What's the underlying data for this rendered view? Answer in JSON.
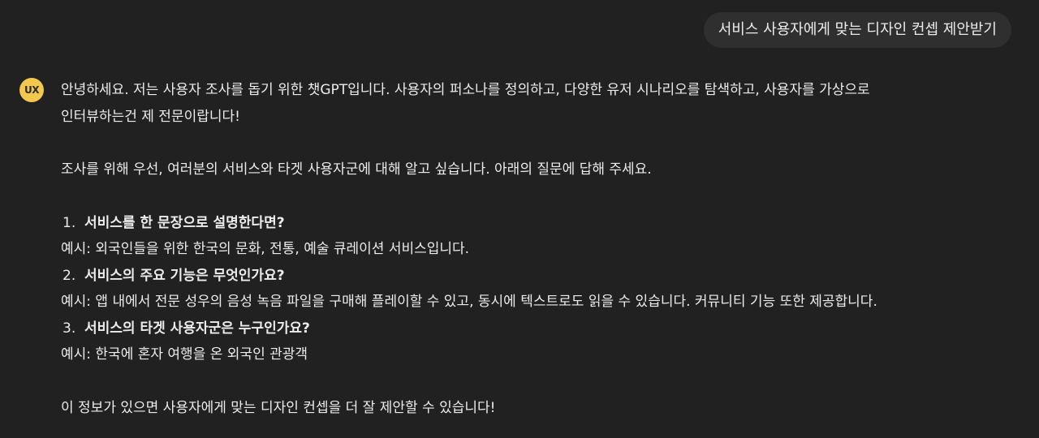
{
  "user_message": "서비스 사용자에게 맞는 디자인 컨셉 제안받기",
  "assistant": {
    "avatar_label": "UX",
    "intro_line1": "안녕하세요. 저는 사용자 조사를 돕기 위한 챗GPT입니다. 사용자의 퍼소나를 정의하고, 다양한 유저 시나리오를 탐색하고, 사용자를 가상으로",
    "intro_line2": "인터뷰하는건 제 전문이랍니다!",
    "request": "조사를 위해 우선, 여러분의 서비스와 타겟 사용자군에 대해 알고 싶습니다. 아래의 질문에 답해 주세요.",
    "questions": [
      {
        "number": "1.",
        "question": "서비스를 한 문장으로 설명한다면?",
        "example": "예시: 외국인들을 위한 한국의 문화, 전통, 예술 큐레이션 서비스입니다."
      },
      {
        "number": "2.",
        "question": "서비스의 주요 기능은 무엇인가요?",
        "example": "예시: 앱 내에서 전문 성우의 음성 녹음 파일을 구매해 플레이할 수 있고, 동시에 텍스트로도 읽을 수 있습니다. 커뮤니티 기능 또한 제공합니다."
      },
      {
        "number": "3.",
        "question": "서비스의 타겟 사용자군은 누구인가요?",
        "example": "예시: 한국에 혼자 여행을 온 외국인 관광객"
      }
    ],
    "closing": "이 정보가 있으면 사용자에게 맞는 디자인 컨셉을 더 잘 제안할 수 있습니다!"
  },
  "colors": {
    "background": "#212121",
    "user_bubble": "#2f2f2f",
    "avatar": "#f2c94c",
    "text": "#ececec"
  }
}
